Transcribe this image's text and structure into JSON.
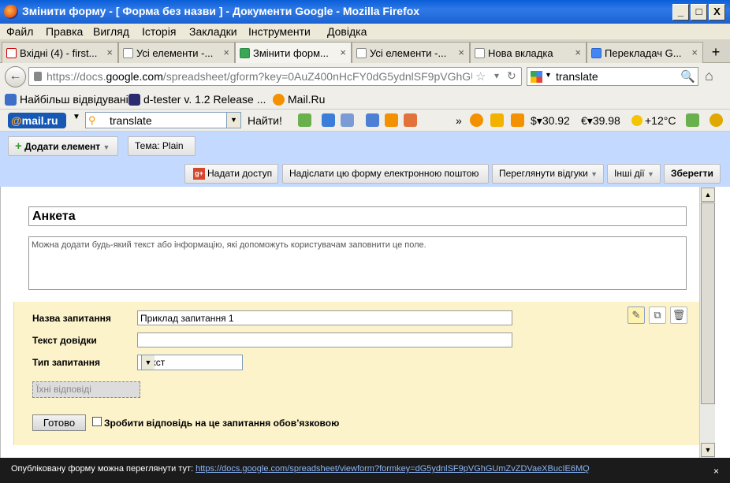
{
  "window": {
    "title": "Змінити форму - [ Форма без назви ] - Документи Google - Mozilla Firefox",
    "minimize": "_",
    "maximize": "□",
    "close": "X"
  },
  "menu": [
    "Файл",
    "Правка",
    "Вигляд",
    "Історія",
    "Закладки",
    "Інструменти",
    "Довідка"
  ],
  "tabs": [
    {
      "label": "Вхідні (4) - first...",
      "active": false
    },
    {
      "label": "Усі елементи -...",
      "active": false
    },
    {
      "label": "Змінити форм...",
      "active": true
    },
    {
      "label": "Усі елементи -...",
      "active": false
    },
    {
      "label": "Нова вкладка",
      "active": false
    },
    {
      "label": "Перекладач G...",
      "active": false
    }
  ],
  "tab_close": "×",
  "new_tab": "+",
  "nav": {
    "url_prefix": "https://docs.",
    "url_domain": "google.com",
    "url_rest": "/spreadsheet/gform?key=0AuZ400nHcFY0dG5ydnlSF9pVGhGU",
    "search_value": "translate"
  },
  "bookmarks": [
    {
      "label": "Найбільш відвідувані"
    },
    {
      "label": "d-tester v. 1.2 Release ..."
    },
    {
      "label": "Mail.Ru"
    }
  ],
  "mailru_bar": {
    "logo_at": "@",
    "logo_text": "mail.ru",
    "search_value": "translate",
    "find_label": "Найти!",
    "more": "»",
    "usd": "$▾30.92",
    "eur": "€▾39.98",
    "weather": "+12°C"
  },
  "forms_header": {
    "add_item_label": "Додати елемент",
    "theme_label": "Тема:  Plain",
    "share_label": "Надати доступ",
    "email_form_label": "Надіслати цю форму електронною поштою",
    "view_responses_label": "Переглянути відгуки",
    "more_actions_label": "Інші дії",
    "save_label": "Зберегти"
  },
  "form": {
    "title": "Анкета",
    "description_placeholder": "Можна додати будь-який текст або інформацію, які допоможуть користувачам заповнити це поле.",
    "question": {
      "title_label": "Назва запитання",
      "title_value": "Приклад запитання 1",
      "help_label": "Текст довідки",
      "help_value": "",
      "type_label": "Тип запитання",
      "type_value": "Текст",
      "answers_placeholder": "Їхні відповіді",
      "done_label": "Готово",
      "required_label": "Зробити відповідь на це запитання обов’язковою"
    }
  },
  "status": {
    "text": "Опубліковану форму можна переглянути тут: ",
    "link": "https://docs.google.com/spreadsheet/viewform?formkey=dG5ydnlSF9pVGhGUmZvZDVaeXBucIE6MQ"
  }
}
